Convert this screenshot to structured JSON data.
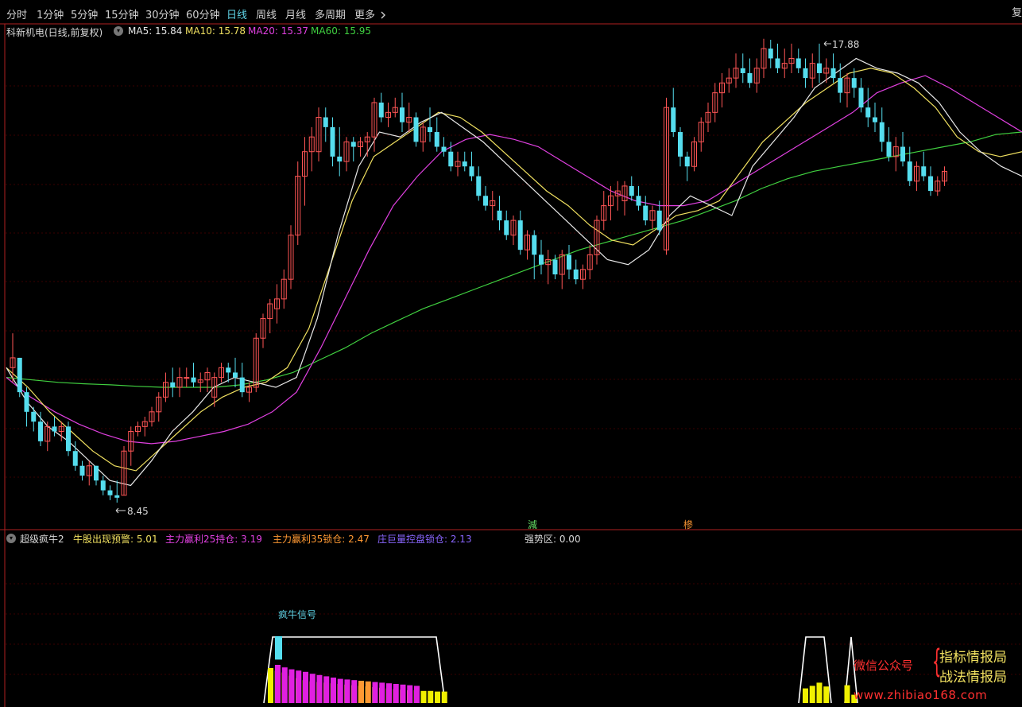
{
  "toolbar": {
    "tabs": [
      "分时",
      "1分钟",
      "5分钟",
      "15分钟",
      "30分钟",
      "60分钟",
      "日线",
      "周线",
      "月线",
      "多周期",
      "更多"
    ],
    "active_tab": "日线",
    "more_icon": "chevron-right-icon",
    "corner_label": "复"
  },
  "main_chart": {
    "stock_label": "科新机电(日线,前复权)",
    "indicator_toggle_icon": "circle-toggle-icon",
    "ma_legend": [
      {
        "label": "MA5: 15.84",
        "color": "#e8e8e8"
      },
      {
        "label": "MA10: 15.78",
        "color": "#f0e060"
      },
      {
        "label": "MA20: 15.37",
        "color": "#e040e0"
      },
      {
        "label": "MA60: 15.95",
        "color": "#40d040"
      }
    ],
    "high_label": "17.88",
    "low_label": "8.45",
    "markers": [
      {
        "text": "減",
        "color": "#66dd66"
      },
      {
        "text": "槮",
        "color": "#ff9933"
      }
    ]
  },
  "sub_chart": {
    "title": "超级疯牛2",
    "legend": [
      {
        "label": "牛股出现预警: 5.01",
        "color": "#f0e060"
      },
      {
        "label": "主力赢利25持仓: 3.19",
        "color": "#e040e0"
      },
      {
        "label": "主力赢利35锁仓: 2.47",
        "color": "#ff9933"
      },
      {
        "label": "庄巨量控盘锁仓: 2.13",
        "color": "#8a66ff"
      }
    ],
    "strength_label": "强势区: 0.00",
    "signal_label": "疯牛信号"
  },
  "watermark": {
    "wechat": "微信公众号",
    "brace": "{",
    "line1": "指标情报局",
    "line2": "战法情报局",
    "url": "www.zhibiao168.com"
  },
  "colors": {
    "up": "#ff5555",
    "down": "#55ddee",
    "grid": "#3a0000",
    "separator": "#b02020"
  },
  "chart_data": {
    "type": "candlestick",
    "price_range": [
      8.45,
      17.88
    ],
    "ohlc": [
      [
        11.2,
        11.9,
        10.9,
        11.4
      ],
      [
        11.4,
        11.4,
        10.6,
        10.7
      ],
      [
        10.7,
        10.8,
        10.0,
        10.3
      ],
      [
        10.3,
        10.4,
        9.9,
        10.1
      ],
      [
        10.1,
        10.3,
        9.6,
        9.7
      ],
      [
        9.7,
        10.1,
        9.5,
        10.0
      ],
      [
        10.0,
        10.2,
        9.8,
        9.9
      ],
      [
        9.9,
        10.1,
        9.7,
        10.0
      ],
      [
        10.0,
        10.1,
        9.4,
        9.5
      ],
      [
        9.5,
        9.7,
        9.1,
        9.2
      ],
      [
        9.2,
        9.3,
        8.9,
        9.0
      ],
      [
        9.0,
        9.3,
        8.8,
        9.2
      ],
      [
        9.2,
        9.2,
        8.8,
        8.9
      ],
      [
        8.9,
        9.0,
        8.6,
        8.7
      ],
      [
        8.7,
        8.8,
        8.5,
        8.6
      ],
      [
        8.6,
        8.9,
        8.45,
        8.55
      ],
      [
        8.6,
        9.6,
        8.6,
        9.5
      ],
      [
        9.5,
        10.0,
        9.2,
        9.9
      ],
      [
        9.9,
        10.1,
        9.8,
        10.0
      ],
      [
        10.0,
        10.2,
        9.8,
        10.1
      ],
      [
        10.1,
        10.4,
        10.0,
        10.3
      ],
      [
        10.3,
        10.7,
        10.1,
        10.6
      ],
      [
        10.6,
        11.1,
        10.5,
        10.9
      ],
      [
        10.9,
        11.2,
        10.6,
        10.8
      ],
      [
        10.8,
        11.2,
        10.6,
        11.0
      ],
      [
        11.0,
        11.2,
        10.8,
        11.0
      ],
      [
        11.0,
        11.3,
        10.8,
        10.9
      ],
      [
        10.9,
        11.1,
        10.7,
        10.95
      ],
      [
        10.95,
        11.2,
        10.7,
        11.1
      ],
      [
        10.6,
        11.1,
        10.4,
        11.0
      ],
      [
        11.0,
        11.3,
        10.9,
        11.2
      ],
      [
        11.2,
        11.3,
        10.9,
        11.1
      ],
      [
        11.1,
        11.4,
        10.8,
        11.0
      ],
      [
        11.0,
        11.3,
        10.6,
        10.7
      ],
      [
        10.7,
        10.9,
        10.5,
        10.8
      ],
      [
        10.8,
        11.9,
        10.7,
        11.8
      ],
      [
        11.8,
        12.3,
        11.6,
        12.2
      ],
      [
        12.2,
        12.6,
        11.9,
        12.5
      ],
      [
        12.4,
        12.9,
        12.1,
        12.6
      ],
      [
        12.6,
        13.2,
        12.4,
        13.0
      ],
      [
        13.0,
        14.1,
        12.8,
        13.9
      ],
      [
        13.9,
        15.4,
        13.7,
        15.1
      ],
      [
        15.1,
        15.9,
        14.5,
        15.6
      ],
      [
        15.6,
        16.1,
        15.2,
        15.9
      ],
      [
        15.6,
        16.5,
        15.4,
        16.3
      ],
      [
        16.3,
        16.5,
        15.8,
        16.1
      ],
      [
        16.1,
        16.3,
        15.3,
        15.5
      ],
      [
        15.5,
        16.1,
        15.1,
        15.4
      ],
      [
        15.4,
        15.9,
        15.2,
        15.8
      ],
      [
        15.8,
        15.9,
        15.4,
        15.7
      ],
      [
        15.7,
        15.9,
        15.5,
        15.8
      ],
      [
        15.8,
        16.0,
        15.5,
        15.9
      ],
      [
        15.9,
        16.7,
        15.6,
        16.6
      ],
      [
        16.6,
        16.8,
        16.2,
        16.3
      ],
      [
        16.3,
        16.6,
        16.1,
        16.4
      ],
      [
        16.4,
        16.7,
        16.3,
        16.5
      ],
      [
        16.5,
        16.8,
        16.0,
        16.2
      ],
      [
        16.2,
        16.6,
        16.0,
        16.3
      ],
      [
        16.3,
        16.4,
        15.7,
        15.8
      ],
      [
        15.8,
        16.2,
        15.6,
        16.1
      ],
      [
        16.1,
        16.5,
        15.8,
        16.0
      ],
      [
        16.0,
        16.3,
        15.6,
        15.7
      ],
      [
        15.7,
        15.9,
        15.5,
        15.6
      ],
      [
        15.6,
        15.8,
        15.2,
        15.3
      ],
      [
        15.3,
        15.6,
        15.1,
        15.4
      ],
      [
        15.4,
        15.6,
        15.2,
        15.3
      ],
      [
        15.3,
        15.6,
        15.0,
        15.1
      ],
      [
        15.1,
        15.3,
        14.6,
        14.7
      ],
      [
        14.7,
        14.9,
        14.4,
        14.5
      ],
      [
        14.5,
        14.8,
        14.2,
        14.6
      ],
      [
        14.4,
        14.7,
        14.0,
        14.2
      ],
      [
        14.2,
        14.4,
        13.8,
        13.9
      ],
      [
        13.9,
        14.3,
        13.7,
        14.2
      ],
      [
        14.2,
        14.4,
        13.5,
        13.6
      ],
      [
        13.6,
        14.0,
        13.4,
        13.9
      ],
      [
        13.9,
        14.0,
        13.0,
        13.5
      ],
      [
        13.5,
        13.8,
        13.1,
        13.3
      ],
      [
        13.3,
        13.6,
        12.9,
        13.4
      ],
      [
        13.4,
        13.5,
        13.0,
        13.1
      ],
      [
        13.1,
        13.6,
        12.8,
        13.5
      ],
      [
        13.5,
        13.7,
        13.0,
        13.2
      ],
      [
        13.2,
        13.4,
        12.9,
        13.0
      ],
      [
        13.0,
        13.3,
        12.8,
        13.2
      ],
      [
        13.2,
        13.7,
        13.0,
        13.5
      ],
      [
        13.5,
        14.3,
        13.3,
        14.2
      ],
      [
        14.2,
        14.8,
        14.0,
        14.5
      ],
      [
        14.5,
        14.9,
        14.2,
        14.7
      ],
      [
        14.7,
        15.0,
        14.4,
        14.8
      ],
      [
        14.6,
        15.0,
        14.3,
        14.9
      ],
      [
        14.9,
        15.1,
        14.6,
        14.7
      ],
      [
        14.7,
        14.9,
        14.4,
        14.5
      ],
      [
        14.5,
        14.7,
        14.1,
        14.2
      ],
      [
        14.2,
        14.5,
        14.0,
        14.4
      ],
      [
        14.4,
        14.6,
        13.9,
        14.0
      ],
      [
        13.6,
        16.7,
        13.5,
        16.5
      ],
      [
        16.5,
        16.9,
        15.9,
        16.0
      ],
      [
        16.0,
        16.1,
        15.3,
        15.5
      ],
      [
        15.5,
        15.6,
        15.0,
        15.3
      ],
      [
        15.3,
        15.9,
        15.2,
        15.8
      ],
      [
        15.8,
        16.3,
        15.6,
        16.2
      ],
      [
        16.2,
        16.6,
        16.0,
        16.4
      ],
      [
        16.4,
        17.0,
        16.2,
        16.8
      ],
      [
        16.8,
        17.2,
        16.5,
        17.0
      ],
      [
        17.0,
        17.3,
        16.8,
        17.1
      ],
      [
        17.1,
        17.6,
        16.9,
        17.3
      ],
      [
        17.3,
        17.6,
        17.0,
        17.2
      ],
      [
        17.2,
        17.5,
        16.9,
        17.0
      ],
      [
        17.0,
        17.5,
        16.8,
        17.3
      ],
      [
        17.3,
        17.9,
        17.1,
        17.7
      ],
      [
        17.7,
        17.88,
        17.3,
        17.5
      ],
      [
        17.5,
        17.8,
        17.2,
        17.3
      ],
      [
        17.3,
        17.7,
        17.1,
        17.4
      ],
      [
        17.4,
        17.8,
        17.2,
        17.5
      ],
      [
        17.5,
        17.7,
        17.2,
        17.3
      ],
      [
        17.3,
        17.5,
        16.9,
        17.1
      ],
      [
        17.1,
        17.6,
        16.9,
        17.4
      ],
      [
        17.4,
        17.8,
        17.0,
        17.2
      ],
      [
        17.2,
        17.5,
        17.0,
        17.3
      ],
      [
        17.3,
        17.6,
        17.0,
        17.1
      ],
      [
        17.1,
        17.4,
        16.6,
        16.8
      ],
      [
        16.8,
        17.2,
        16.5,
        17.1
      ],
      [
        17.1,
        17.3,
        16.7,
        16.9
      ],
      [
        16.9,
        17.1,
        16.4,
        16.5
      ],
      [
        16.5,
        16.9,
        16.1,
        16.3
      ],
      [
        16.3,
        16.6,
        16.0,
        16.2
      ],
      [
        16.2,
        16.5,
        15.6,
        15.8
      ],
      [
        15.8,
        16.1,
        15.4,
        15.5
      ],
      [
        15.5,
        15.9,
        15.2,
        15.7
      ],
      [
        15.7,
        16.0,
        15.3,
        15.4
      ],
      [
        15.4,
        15.7,
        14.9,
        15.0
      ],
      [
        15.0,
        15.4,
        14.8,
        15.3
      ],
      [
        15.3,
        15.6,
        15.0,
        15.1
      ],
      [
        15.1,
        15.3,
        14.7,
        14.8
      ],
      [
        14.8,
        15.1,
        14.7,
        15.0
      ],
      [
        15.0,
        15.3,
        14.9,
        15.2
      ]
    ],
    "ma_series": [
      {
        "name": "MA60",
        "color": "#40d040",
        "values": [
          11.0,
          10.95,
          10.9,
          10.87,
          10.85,
          10.82,
          10.8,
          10.8,
          10.8,
          10.85,
          10.95,
          11.1,
          11.35,
          11.6,
          11.9,
          12.15,
          12.4,
          12.6,
          12.8,
          13.0,
          13.2,
          13.4,
          13.6,
          13.75,
          13.9,
          14.05,
          14.2,
          14.4,
          14.6,
          14.85,
          15.05,
          15.2,
          15.3,
          15.4,
          15.5,
          15.6,
          15.7,
          15.8,
          15.95,
          16.0
        ]
      },
      {
        "name": "MA20",
        "color": "#e040e0",
        "values": [
          11.0,
          10.6,
          10.3,
          10.05,
          9.85,
          9.7,
          9.65,
          9.7,
          9.8,
          9.9,
          10.05,
          10.3,
          10.7,
          11.6,
          12.6,
          13.6,
          14.5,
          15.1,
          15.6,
          15.85,
          15.95,
          15.85,
          15.7,
          15.4,
          15.1,
          14.8,
          14.6,
          14.5,
          14.5,
          14.6,
          14.9,
          15.2,
          15.5,
          15.8,
          16.1,
          16.4,
          16.8,
          17.0,
          17.15,
          16.9,
          16.6,
          16.3,
          16.0
        ]
      },
      {
        "name": "MA10",
        "color": "#f0e060",
        "values": [
          11.2,
          10.8,
          10.3,
          9.9,
          9.5,
          9.2,
          9.1,
          9.5,
          9.9,
          10.3,
          10.6,
          10.8,
          10.9,
          11.2,
          12.0,
          13.3,
          14.6,
          15.5,
          15.8,
          16.1,
          16.4,
          16.3,
          16.0,
          15.6,
          15.2,
          14.8,
          14.5,
          14.1,
          13.8,
          13.7,
          14.0,
          14.3,
          14.4,
          14.6,
          15.2,
          15.8,
          16.2,
          16.6,
          16.9,
          17.2,
          17.3,
          17.2,
          16.9,
          16.5,
          15.9,
          15.6,
          15.5,
          15.6
        ]
      },
      {
        "name": "MA5",
        "color": "#e8e8e8",
        "values": [
          11.2,
          10.5,
          10.0,
          9.7,
          9.3,
          8.9,
          8.8,
          9.3,
          9.9,
          10.3,
          10.8,
          11.0,
          10.9,
          10.8,
          11.0,
          12.2,
          13.9,
          15.3,
          16.0,
          15.9,
          16.2,
          16.4,
          16.1,
          15.8,
          15.4,
          15.0,
          14.6,
          14.2,
          13.8,
          13.4,
          13.3,
          13.6,
          14.3,
          14.7,
          14.5,
          14.3,
          15.3,
          15.8,
          16.3,
          16.9,
          17.2,
          17.5,
          17.3,
          17.2,
          17.0,
          16.6,
          16.0,
          15.6,
          15.3,
          15.1
        ]
      }
    ],
    "sub_indicators": {
      "warning_values": [
        5.0,
        5.0,
        5.0,
        5.0,
        5.0,
        5.0,
        5.0,
        5.0,
        5.0,
        5.0,
        5.0,
        5.0,
        5.0,
        5.0,
        5.0,
        5.0,
        5.0,
        5.0,
        5.0,
        5.0,
        5.0,
        5.0,
        5.0,
        5.0,
        5.0,
        5.0,
        5.0,
        5.0,
        5.0,
        5.0,
        5.0,
        5.0,
        5.0,
        5.0,
        5.0,
        5.0,
        5.0
      ],
      "yellow_bars": [
        5.5,
        5.1,
        4.8,
        4.3,
        3.9,
        3.6,
        3.4,
        3.3,
        3.2,
        3.1,
        3.0,
        2.9,
        2.8,
        2.7,
        2.6,
        2.5,
        2.4,
        2.3,
        2.2,
        2.1,
        2.0,
        2.0,
        1.9,
        1.9,
        1.8,
        1.8
      ],
      "magenta_bars": [
        6.0,
        5.6,
        5.3,
        5.1,
        4.9,
        4.6,
        4.4,
        4.2,
        4.0,
        3.8,
        3.7,
        3.6,
        3.5,
        3.4,
        3.3,
        3.2,
        3.1,
        3.0,
        2.9,
        2.8,
        2.7
      ],
      "cyan_bar": 10.5,
      "right_yellow_bars": [
        2.3,
        2.7,
        3.2,
        2.6,
        0,
        0,
        2.8,
        1.3
      ]
    }
  }
}
